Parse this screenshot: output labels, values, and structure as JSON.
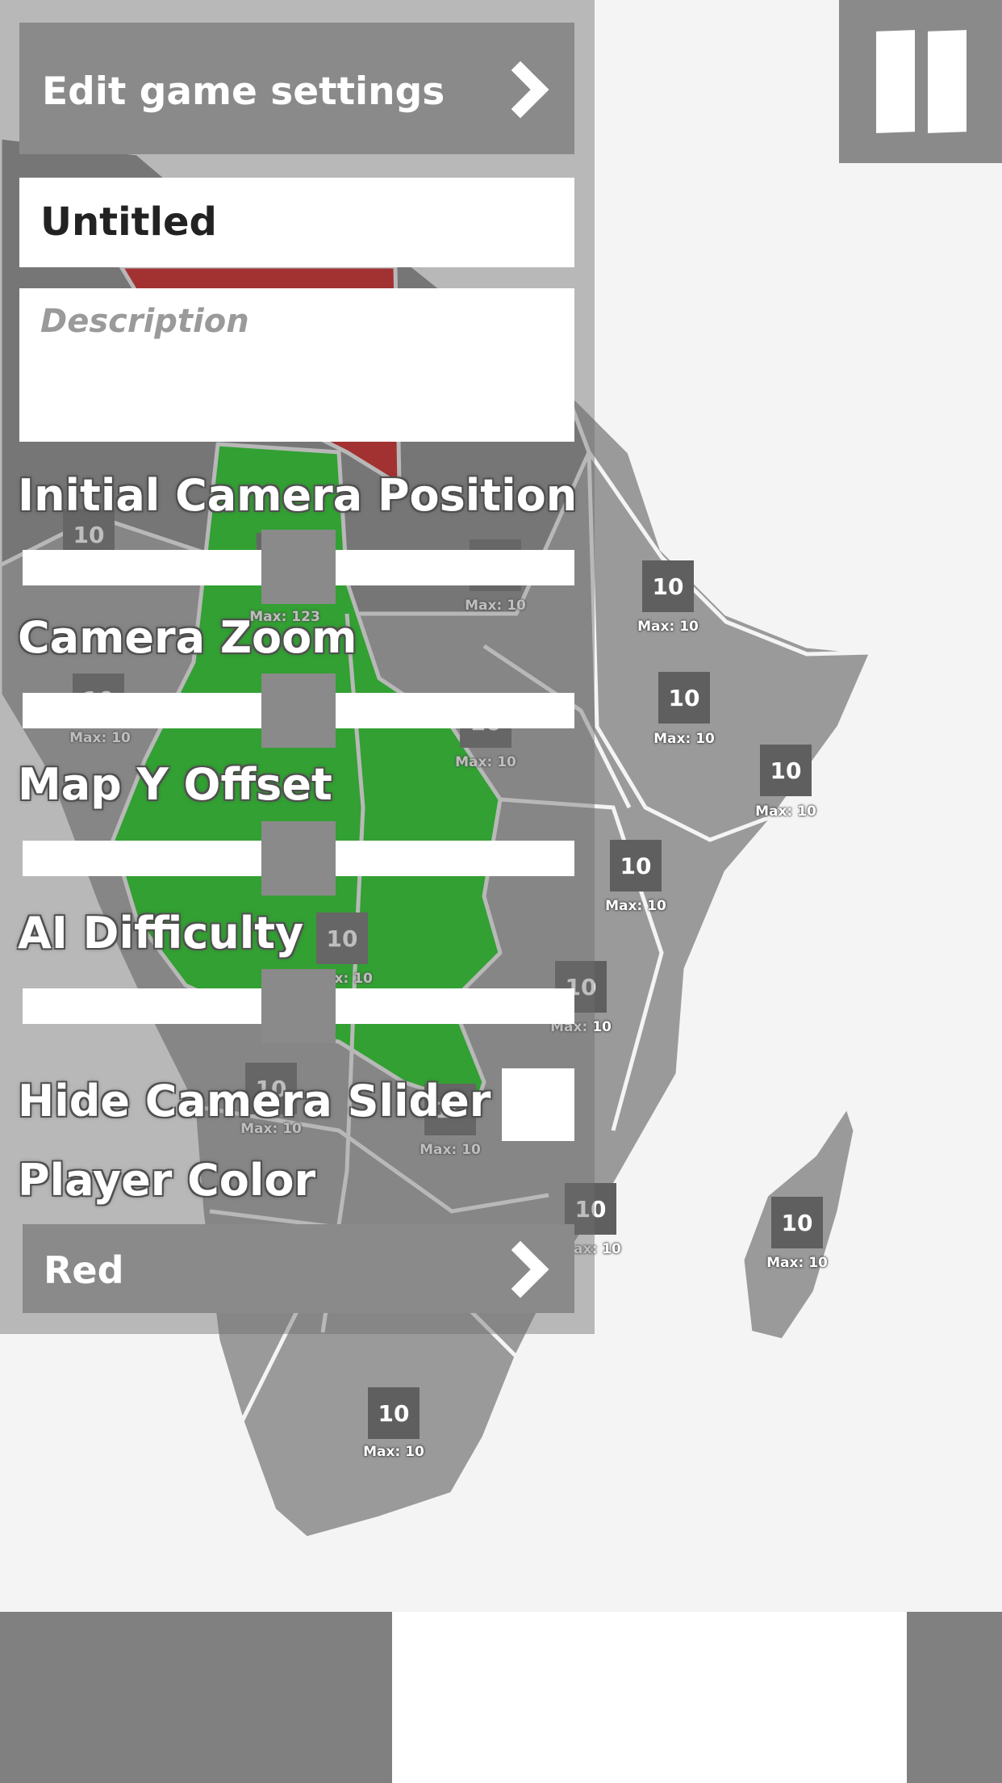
{
  "settings": {
    "header_label": "Edit game settings",
    "title_value": "Untitled",
    "description_placeholder": "Description",
    "sliders": {
      "camera_position": {
        "label": "Initial Camera Position",
        "value": 0.5
      },
      "camera_zoom": {
        "label": "Camera Zoom",
        "value": 0.5
      },
      "map_y_offset": {
        "label": "Map Y Offset",
        "value": 0.5
      },
      "ai_difficulty": {
        "label": "AI Difficulty",
        "value": 0.5
      }
    },
    "hide_camera_slider_label": "Hide Camera Slider",
    "player_color_label": "Player Color",
    "player_color_value": "Red"
  },
  "map": {
    "colors": {
      "neutral": "#9a9a9a",
      "player_green": "#00c800",
      "player_red": "#cc0000"
    },
    "regions": [
      {
        "troops": "10",
        "max": "Max: 10"
      },
      {
        "troops": "10",
        "max": "Max: 123"
      },
      {
        "troops": "10",
        "max": "Max: 10"
      },
      {
        "troops": "10",
        "max": "Max: 10"
      },
      {
        "troops": "10",
        "max": "Max: 10"
      },
      {
        "troops": "10",
        "max": "Max: 10"
      },
      {
        "troops": "10",
        "max": "Max: 10"
      },
      {
        "troops": "10",
        "max": "Max: 10"
      },
      {
        "troops": "10",
        "max": "Max: 10"
      },
      {
        "troops": "10",
        "max": "Max: 10"
      },
      {
        "troops": "10",
        "max": "Max: 10"
      },
      {
        "troops": "10",
        "max": "Max: 10"
      },
      {
        "troops": "10",
        "max": "Max: 10"
      },
      {
        "troops": "10",
        "max": "Max: 10"
      },
      {
        "troops": "10",
        "max": "Max: 10"
      },
      {
        "troops": "10",
        "max": "Max: 10"
      }
    ]
  }
}
